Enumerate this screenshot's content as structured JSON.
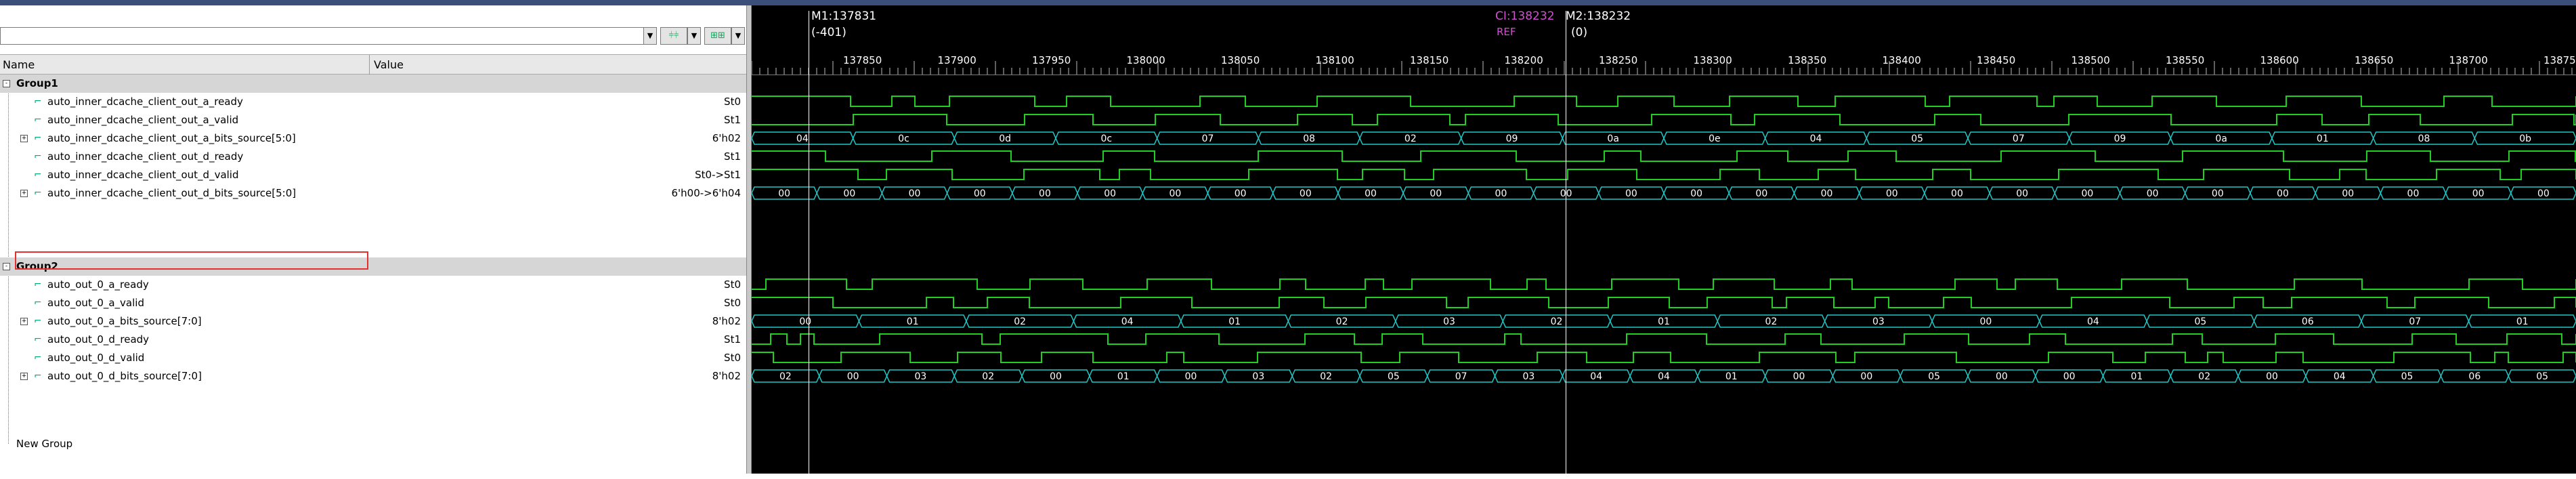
{
  "colors": {
    "trace": "#20d020",
    "bus": "#20c8c8",
    "cursor_ref": "#c040c0",
    "bg": "#000000"
  },
  "markers": {
    "m1": {
      "label": "M1:137831",
      "delta": "(-401)"
    },
    "ci": {
      "label": "CI:138232",
      "ref": "REF"
    },
    "m2": {
      "label": "M2:138232",
      "delta": "(0)"
    }
  },
  "columns": {
    "name": "Name",
    "value": "Value"
  },
  "ruler": [
    "137850",
    "137900",
    "137950",
    "138000",
    "138050",
    "138100",
    "138150",
    "138200",
    "138250",
    "138300",
    "138350",
    "138400",
    "138450",
    "138500",
    "138550",
    "138600",
    "138650",
    "138700",
    "13875"
  ],
  "groups": [
    {
      "name": "Group1",
      "signals": [
        {
          "name": "auto_inner_dcache_client_out_a_ready",
          "value": "St0",
          "bus": false,
          "icon": "signal-wave-icon"
        },
        {
          "name": "auto_inner_dcache_client_out_a_valid",
          "value": "St1",
          "bus": false,
          "icon": "signal-wave-icon"
        },
        {
          "name": "auto_inner_dcache_client_out_a_bits_source[5:0]",
          "value": "6'h02",
          "bus": true,
          "icon": "bus-icon"
        },
        {
          "name": "auto_inner_dcache_client_out_d_ready",
          "value": "St1",
          "bus": false,
          "icon": "signal-wave-icon"
        },
        {
          "name": "auto_inner_dcache_client_out_d_valid",
          "value": "St0->St1",
          "bus": false,
          "icon": "signal-wave-icon"
        },
        {
          "name": "auto_inner_dcache_client_out_d_bits_source[5:0]",
          "value": "6'h00->6'h04",
          "bus": true,
          "icon": "bus-icon"
        }
      ]
    },
    {
      "name": "Group2",
      "signals": [
        {
          "name": "auto_out_0_a_ready",
          "value": "St0",
          "bus": false,
          "icon": "signal-wave-icon"
        },
        {
          "name": "auto_out_0_a_valid",
          "value": "St0",
          "bus": false,
          "icon": "signal-wave-icon"
        },
        {
          "name": "auto_out_0_a_bits_source[7:0]",
          "value": "8'h02",
          "bus": true,
          "icon": "bus-icon"
        },
        {
          "name": "auto_out_0_d_ready",
          "value": "St1",
          "bus": false,
          "icon": "signal-wave-icon"
        },
        {
          "name": "auto_out_0_d_valid",
          "value": "St0",
          "bus": false,
          "icon": "signal-wave-icon"
        },
        {
          "name": "auto_out_0_d_bits_source[7:0]",
          "value": "8'h02",
          "bus": true,
          "icon": "bus-icon"
        }
      ]
    }
  ],
  "new_group": "New Group",
  "bus_values": {
    "a_bits_g1": [
      "04",
      "0c",
      "0d",
      "0c",
      "07",
      "08",
      "02",
      "09",
      "0a",
      "0e",
      "04",
      "05",
      "07",
      "09",
      "0a",
      "01",
      "08",
      "0b"
    ],
    "d_bits_g1": [
      "00",
      "00",
      "00",
      "00",
      "00",
      "00",
      "00",
      "00",
      "00",
      "00",
      "00",
      "00",
      "00",
      "00",
      "00",
      "00",
      "00",
      "00",
      "00",
      "00",
      "00",
      "00",
      "00",
      "00",
      "00",
      "00",
      "00",
      "00"
    ],
    "a_bits_g2": [
      "00",
      "01",
      "02",
      "04",
      "01",
      "02",
      "03",
      "02",
      "01",
      "02",
      "03",
      "00",
      "04",
      "05",
      "06",
      "07",
      "01"
    ],
    "d_bits_g2": [
      "02",
      "00",
      "03",
      "02",
      "00",
      "01",
      "00",
      "03",
      "02",
      "05",
      "07",
      "03",
      "04",
      "04",
      "01",
      "00",
      "00",
      "05",
      "00",
      "00",
      "01",
      "02",
      "00",
      "04",
      "05",
      "06",
      "05"
    ]
  }
}
